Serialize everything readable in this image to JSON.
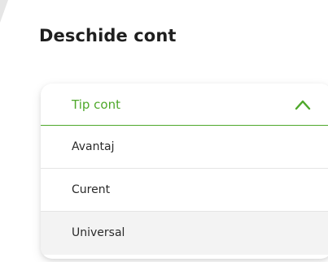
{
  "page": {
    "title": "Deschide cont"
  },
  "dropdown": {
    "label": "Tip cont",
    "expanded": true,
    "accent_color": "#4ea82a",
    "chevron_icon": "chevron-up-icon",
    "options": [
      {
        "label": "Avantaj"
      },
      {
        "label": "Curent"
      },
      {
        "label": "Universal",
        "highlighted": true
      }
    ]
  }
}
